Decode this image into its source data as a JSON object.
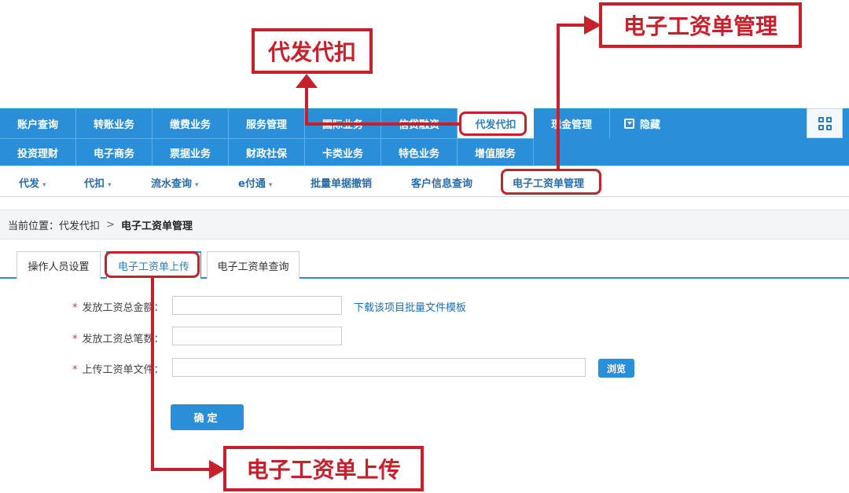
{
  "nav": {
    "row1": [
      "账户查询",
      "转账业务",
      "缴费业务",
      "服务管理",
      "国际业务",
      "信贷融资",
      "代发代扣",
      "现金管理",
      "隐藏"
    ],
    "row2": [
      "投资理财",
      "电子商务",
      "票据业务",
      "财政社保",
      "卡类业务",
      "特色业务",
      "增值服务"
    ]
  },
  "subnav": {
    "items": [
      "代发",
      "代扣",
      "流水查询",
      "e付通",
      "批量单据撤销",
      "客户信息查询",
      "电子工资单管理"
    ]
  },
  "breadcrumb": {
    "prefix": "当前位置：",
    "parent": "代发代扣",
    "current": "电子工资单管理"
  },
  "tabs": [
    "操作人员设置",
    "电子工资单上传",
    "电子工资单查询"
  ],
  "form": {
    "required_mark": "*",
    "field_amount": "发放工资总金额：",
    "field_count": "发放工资总笔数：",
    "field_file": "上传工资单文件：",
    "download_link": "下载该项目批量文件模板",
    "browse": "浏览",
    "submit": "确定"
  },
  "annotations": {
    "top_left": "代发代扣",
    "top_right": "电子工资单管理",
    "bottom": "电子工资单上传"
  },
  "colors": {
    "nav_blue": "#2a8fd8",
    "annotation_red": "#c8202b"
  }
}
